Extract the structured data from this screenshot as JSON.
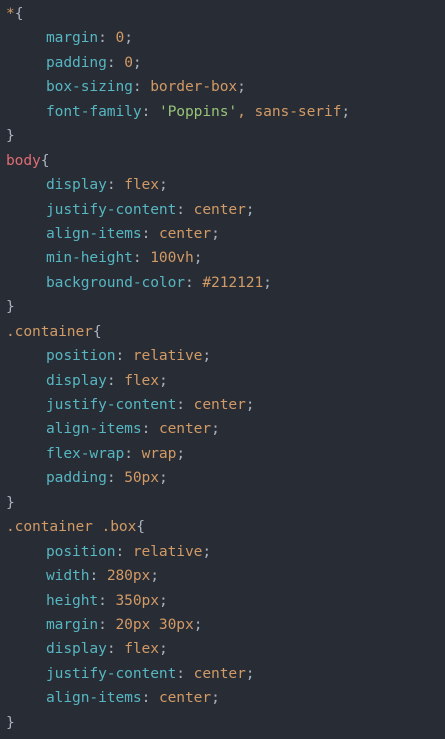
{
  "editor": {
    "theme_colors": {
      "background": "#282c34",
      "property": "#56b6c2",
      "value": "#d19a66",
      "selector_tag": "#e06c75",
      "string": "#98c379"
    },
    "blocks": [
      {
        "selector": "*",
        "open": "{",
        "close": "}",
        "decls": [
          {
            "prop": "margin",
            "val": "0",
            "is_string": false
          },
          {
            "prop": "padding",
            "val": "0",
            "is_string": false
          },
          {
            "prop": "box-sizing",
            "val": "border-box",
            "is_string": false
          },
          {
            "prop": "font-family",
            "val": "'Poppins'",
            "is_string": true,
            "rest": ", sans-serif"
          }
        ]
      },
      {
        "selector": "body",
        "open": "{",
        "close": "}",
        "decls": [
          {
            "prop": "display",
            "val": "flex",
            "is_string": false
          },
          {
            "prop": "justify-content",
            "val": "center",
            "is_string": false
          },
          {
            "prop": "align-items",
            "val": "center",
            "is_string": false
          },
          {
            "prop": "min-height",
            "val": "100vh",
            "is_string": false
          },
          {
            "prop": "background-color",
            "val": "#212121",
            "is_string": false
          }
        ]
      },
      {
        "selector": ".container",
        "open": "{",
        "close": "}",
        "decls": [
          {
            "prop": "position",
            "val": "relative",
            "is_string": false
          },
          {
            "prop": "display",
            "val": "flex",
            "is_string": false
          },
          {
            "prop": "justify-content",
            "val": "center",
            "is_string": false
          },
          {
            "prop": "align-items",
            "val": "center",
            "is_string": false
          },
          {
            "prop": "flex-wrap",
            "val": "wrap",
            "is_string": false
          },
          {
            "prop": "padding",
            "val": "50px",
            "is_string": false
          }
        ]
      },
      {
        "selector": ".container .box",
        "open": "{",
        "close": "}",
        "decls": [
          {
            "prop": "position",
            "val": "relative",
            "is_string": false
          },
          {
            "prop": "width",
            "val": "280px",
            "is_string": false
          },
          {
            "prop": "height",
            "val": "350px",
            "is_string": false
          },
          {
            "prop": "margin",
            "val": "20px 30px",
            "is_string": false
          },
          {
            "prop": "display",
            "val": "flex",
            "is_string": false
          },
          {
            "prop": "justify-content",
            "val": "center",
            "is_string": false
          },
          {
            "prop": "align-items",
            "val": "center",
            "is_string": false
          }
        ]
      }
    ]
  }
}
